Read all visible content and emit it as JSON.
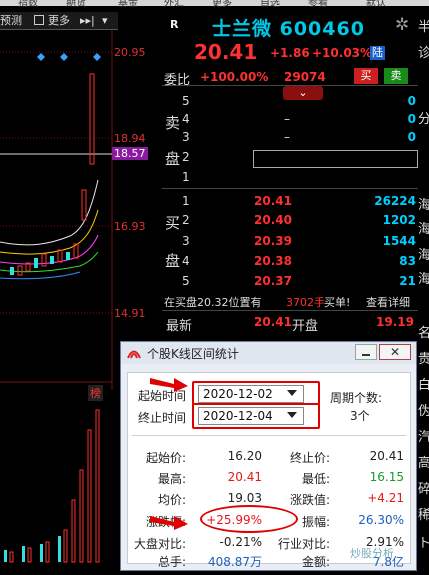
{
  "topbar": {
    "items": [
      "指数",
      "期货",
      "基金",
      "外汇",
      "更多",
      "自选",
      "参看",
      "默认"
    ]
  },
  "toolbar": {
    "forecast_label": "预测",
    "more_label": "更多"
  },
  "chart": {
    "price_ticks": [
      "20.95",
      "18.94",
      "18.57",
      "16.93",
      "14.91"
    ],
    "current_price_tag": "18.57",
    "vol_label": "榜"
  },
  "stock": {
    "badge": "R",
    "name_code": "士兰微 600460",
    "price": "20.41",
    "change": "+1.86",
    "change_pct": "+10.03%",
    "market": "陆"
  },
  "weibi": {
    "label": "委比",
    "pct": "+100.00%",
    "num": "29074",
    "buy": "买",
    "sell": "卖"
  },
  "sell_label": [
    "卖",
    "盘"
  ],
  "buy_label": [
    "买",
    "盘"
  ],
  "sell_book": [
    {
      "lvl": "5",
      "price": "",
      "vol": "0"
    },
    {
      "lvl": "4",
      "price": "–",
      "vol": "0"
    },
    {
      "lvl": "3",
      "price": "–",
      "vol": "0"
    },
    {
      "lvl": "2",
      "price": "",
      "vol": ""
    },
    {
      "lvl": "1",
      "price": "",
      "vol": ""
    }
  ],
  "buy_book": [
    {
      "lvl": "1",
      "price": "20.41",
      "vol": "26224"
    },
    {
      "lvl": "2",
      "price": "20.40",
      "vol": "1202"
    },
    {
      "lvl": "3",
      "price": "20.39",
      "vol": "1544"
    },
    {
      "lvl": "4",
      "price": "20.38",
      "vol": "83"
    },
    {
      "lvl": "5",
      "price": "20.37",
      "vol": "21"
    }
  ],
  "trade_line": {
    "text1": "在买盘20.32位置有",
    "qty": "3702手",
    "text2": "买单!",
    "detail": "查看详细"
  },
  "last_row": {
    "l1": "最新",
    "v1": "20.41",
    "l2": "开盘",
    "v2": "19.19"
  },
  "right_strip": [
    "半",
    "诊",
    "分",
    "海",
    "海",
    "海",
    "海",
    "名",
    "贵",
    "白",
    "伪",
    "汽",
    "高",
    "碎",
    "稀",
    "ト"
  ],
  "dialog": {
    "title": "个股K线区间统计",
    "start_label": "起始时间",
    "end_label": "终止时间",
    "start_date": "2020-12-02",
    "end_date": "2020-12-04",
    "period_label": "周期个数:",
    "period_value": "3个",
    "stats": {
      "start_price_label": "起始价:",
      "start_price": "16.20",
      "end_price_label": "终止价:",
      "end_price": "20.41",
      "high_label": "最高:",
      "high": "20.41",
      "low_label": "最低:",
      "low": "16.15",
      "avg_label": "均价:",
      "avg": "19.03",
      "chg_label": "涨跌值:",
      "chg": "+4.21",
      "pct_label": "涨跌幅:",
      "pct": "+25.99%",
      "amp_label": "振幅:",
      "amp": "26.30%",
      "mkt_label": "大盘对比:",
      "mkt": "-0.21%",
      "ind_label": "行业对比:",
      "ind": "2.91%",
      "vol_label": "总手:",
      "vol": "408.87万",
      "amt_label": "金额:",
      "amt": "7.8亿"
    }
  },
  "watermark": "炒股分析"
}
